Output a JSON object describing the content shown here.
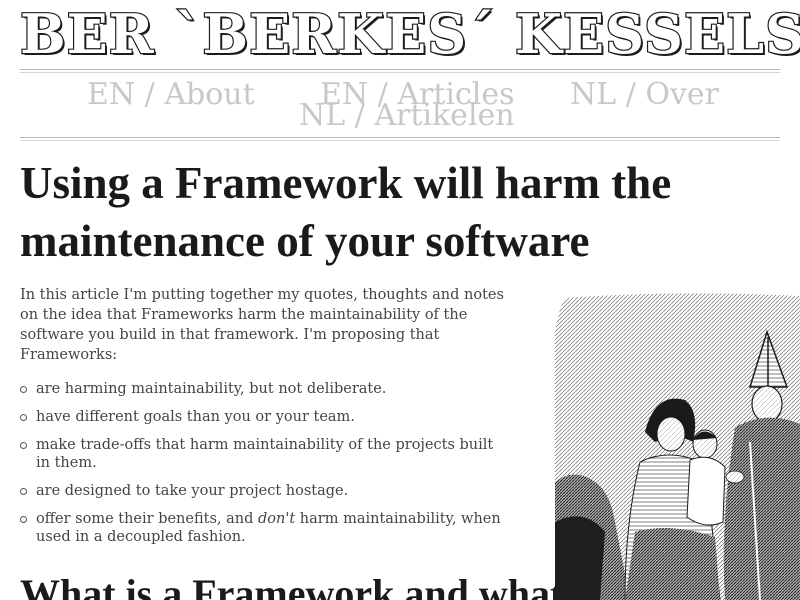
{
  "site": {
    "title": "BER `BERKES´ KESSELS"
  },
  "nav": {
    "items": [
      {
        "label": "EN / About"
      },
      {
        "label": "EN / Articles"
      },
      {
        "label": "NL / Over"
      },
      {
        "label": "NL / Artikelen"
      }
    ]
  },
  "article": {
    "title": "Using a Framework will harm the maintenance of your software",
    "intro": "In this article I'm putting together my quotes, thoughts and notes on the idea that Frameworks harm the maintainability of the software you build in that framework. I'm proposing that Frameworks:",
    "points": [
      {
        "text": "are harming maintainability, but not deliberate."
      },
      {
        "text": "have different goals than you or your team."
      },
      {
        "text": "make trade-offs that harm maintainability of the projects built in them."
      },
      {
        "text": "are designed to take your project hostage."
      },
      {
        "before": "offer some their benefits, and ",
        "emphasis": "don't",
        "after": " harm maintainability, when used in a decoupled fashion."
      }
    ],
    "next_heading": "What is a Framework and what"
  },
  "colors": {
    "text": "#444444",
    "heading": "#1a1a1a",
    "nav": "#c8c8c8",
    "rule": "#b8b8b8"
  },
  "icons": {
    "bullet": "hollow-circle-icon",
    "illustration": "engraving-illustration"
  }
}
